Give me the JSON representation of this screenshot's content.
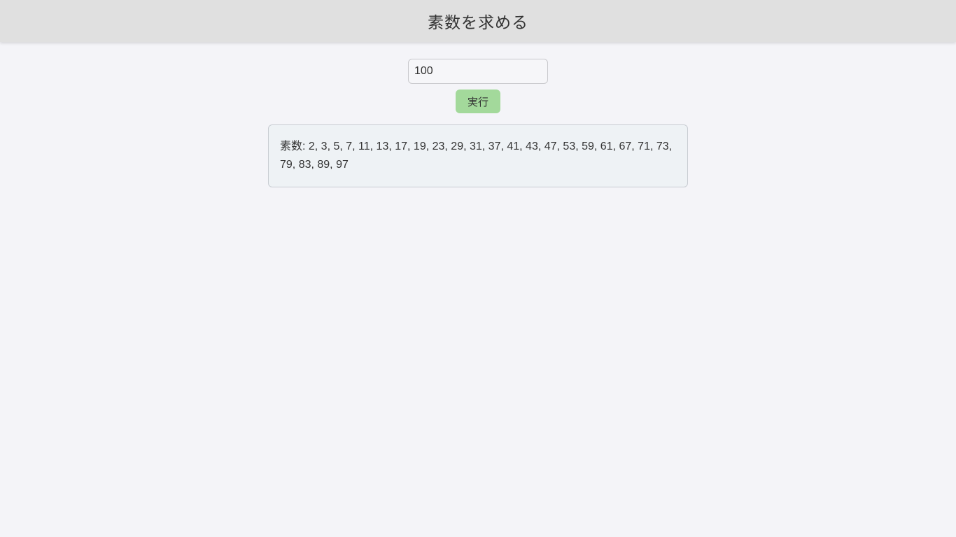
{
  "header": {
    "title": "素数を求める"
  },
  "form": {
    "input_value": "100",
    "run_label": "実行"
  },
  "result": {
    "text": "素数: 2, 3, 5, 7, 11, 13, 17, 19, 23, 29, 31, 37, 41, 43, 47, 53, 59, 61, 67, 71, 73, 79, 83, 89, 97"
  },
  "colors": {
    "header_bg": "#e0e0e0",
    "page_bg": "#f4f4f8",
    "button_bg": "#a3d99b",
    "result_bg": "#eef2f5"
  }
}
